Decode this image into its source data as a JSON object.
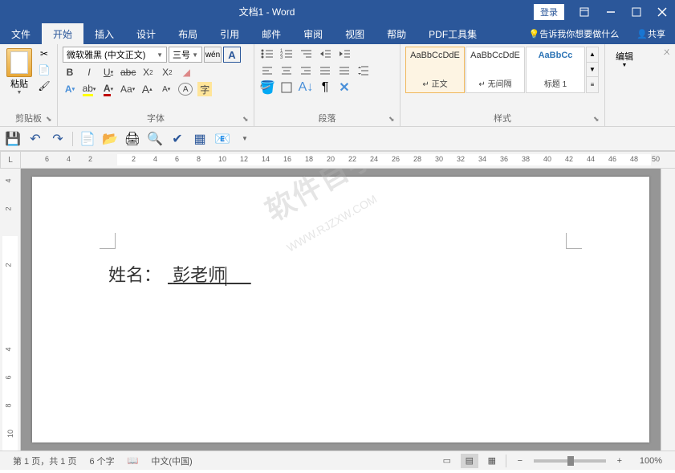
{
  "title": "文档1 - Word",
  "login": "登录",
  "menu": {
    "file": "文件",
    "home": "开始",
    "insert": "插入",
    "design": "设计",
    "layout": "布局",
    "references": "引用",
    "mailings": "邮件",
    "review": "审阅",
    "view": "视图",
    "help": "帮助",
    "pdf": "PDF工具集",
    "tellme": "告诉我你想要做什么",
    "share": "共享"
  },
  "ribbon": {
    "clipboard": {
      "paste": "粘贴",
      "label": "剪贴板"
    },
    "font": {
      "name": "微软雅黑 (中文正文)",
      "size": "三号",
      "label": "字体",
      "wen": "wén",
      "bigA": "A"
    },
    "para": {
      "label": "段落"
    },
    "styles": {
      "label": "样式",
      "s1_preview": "AaBbCcDdE",
      "s1_name": "↵ 正文",
      "s2_preview": "AaBbCcDdE",
      "s2_name": "↵ 无间隔",
      "s3_preview": "AaBbCc",
      "s3_name": "标题 1"
    },
    "edit": {
      "label": "编辑"
    }
  },
  "hruler_ticks": [
    "6",
    "4",
    "2",
    "",
    "2",
    "4",
    "6",
    "8",
    "10",
    "12",
    "14",
    "16",
    "18",
    "20",
    "22",
    "24",
    "26",
    "28",
    "30",
    "32",
    "34",
    "36",
    "38",
    "40",
    "42",
    "44",
    "46",
    "48",
    "50"
  ],
  "vruler_ticks": [
    "4",
    "2",
    "",
    "2",
    "",
    "",
    "4",
    "6",
    "8",
    "10"
  ],
  "doc": {
    "label": "姓名：",
    "value": "彭老师",
    "watermark": "软件自学网",
    "watermark2": "WWW.RJZXW.COM"
  },
  "status": {
    "page": "第 1 页，共 1 页",
    "words": "6 个字",
    "lang": "中文(中国)",
    "zoom": "100%"
  }
}
